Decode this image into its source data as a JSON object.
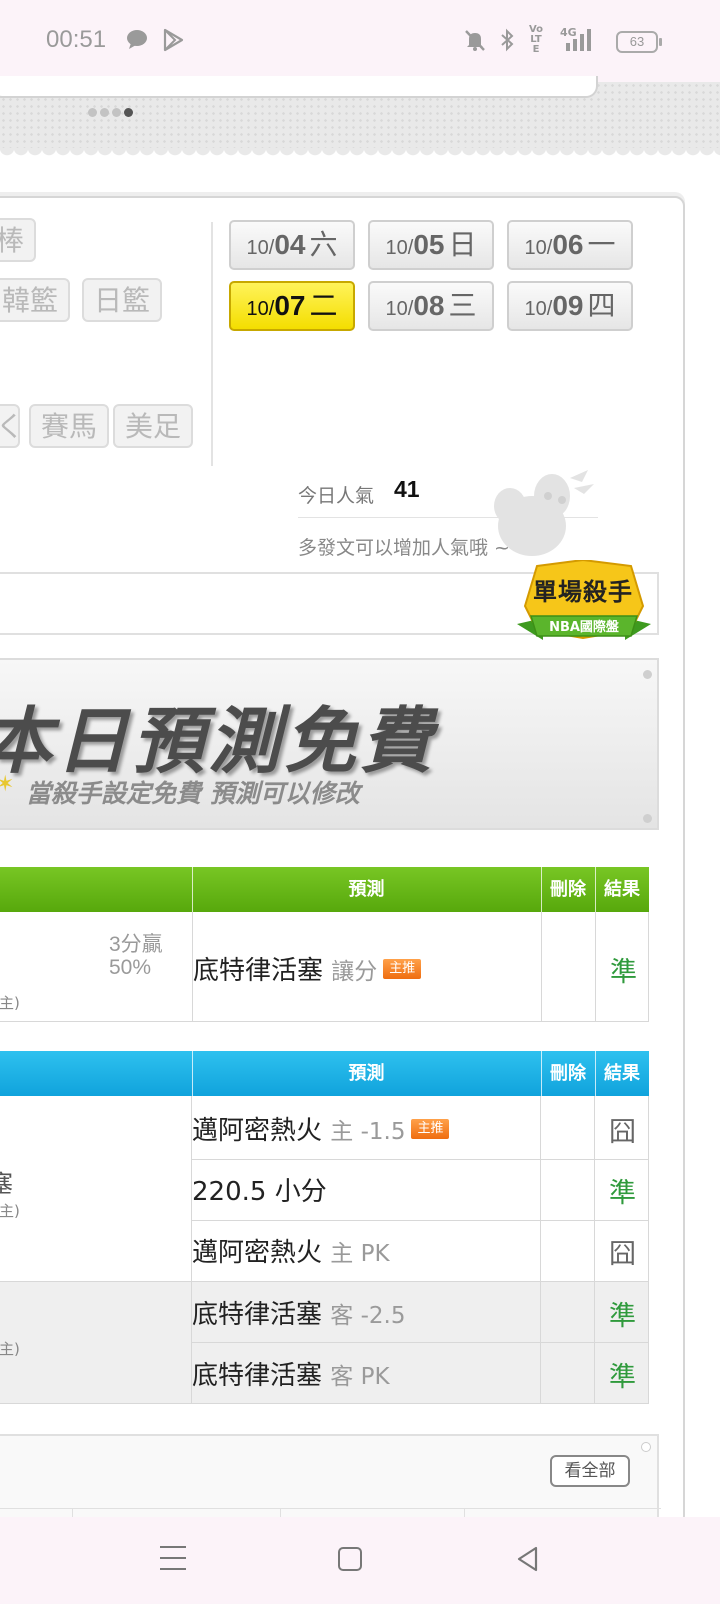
{
  "status_bar": {
    "time": "00:51",
    "icons": [
      "chat-bubble-icon",
      "play-store-icon",
      "mute-bell-icon",
      "bluetooth-icon",
      "volte-icon",
      "4g-signal-icon"
    ],
    "volte": "Vo LTE",
    "network": "4G",
    "battery": "63"
  },
  "sports": {
    "items": [
      "棒",
      "韓籃",
      "日籃",
      "く",
      "賽馬",
      "美足"
    ]
  },
  "dates": [
    {
      "month": "10/",
      "day": "04",
      "weekday": "六",
      "active": false
    },
    {
      "month": "10/",
      "day": "05",
      "weekday": "日",
      "active": false
    },
    {
      "month": "10/",
      "day": "06",
      "weekday": "一",
      "active": false
    },
    {
      "month": "10/",
      "day": "07",
      "weekday": "二",
      "active": true
    },
    {
      "month": "10/",
      "day": "08",
      "weekday": "三",
      "active": false
    },
    {
      "month": "10/",
      "day": "09",
      "weekday": "四",
      "active": false
    }
  ],
  "popularity": {
    "label": "今日人氣",
    "value": "41",
    "tip": "多發文可以增加人氣哦 ~"
  },
  "badge": {
    "title": "單場殺手",
    "subtitle": "NBA國際盤"
  },
  "promo": {
    "title": "本日預測免費",
    "subtitle": "當殺手設定免費  預測可以修改"
  },
  "table1": {
    "headers": {
      "predict": "預測",
      "delete": "刪除",
      "result": "結果"
    },
    "left": {
      "line1": "3分贏",
      "line2": "50%",
      "note": "主)"
    },
    "rows": [
      {
        "team": "底特律活塞",
        "detail": "讓分",
        "tag": "主推",
        "result": "準",
        "status": "ok"
      }
    ]
  },
  "table2": {
    "headers": {
      "predict": "預測",
      "delete": "刪除",
      "result": "結果"
    },
    "group_a": {
      "text": "塞",
      "note": "主)"
    },
    "group_b": {
      "note": "主)"
    },
    "rows": [
      {
        "team": "邁阿密熱火",
        "detail": "主 -1.5",
        "tag": "主推",
        "result": "囧",
        "status": "bad"
      },
      {
        "team": "220.5 小分",
        "detail": "",
        "tag": "",
        "result": "準",
        "status": "ok"
      },
      {
        "team": "邁阿密熱火",
        "detail": "主 PK",
        "tag": "",
        "result": "囧",
        "status": "bad"
      },
      {
        "team": "底特律活塞",
        "detail": "客 -2.5",
        "tag": "",
        "result": "準",
        "status": "ok"
      },
      {
        "team": "底特律活塞",
        "detail": "客 PK",
        "tag": "",
        "result": "準",
        "status": "ok"
      }
    ]
  },
  "more": {
    "label": "看全部"
  },
  "colors": {
    "header_green": "#6abb1a",
    "header_blue": "#1fb2e6",
    "result_ok": "#2f9a3c",
    "active_date": "#ffe900",
    "tag_orange": "#f07a1a"
  }
}
